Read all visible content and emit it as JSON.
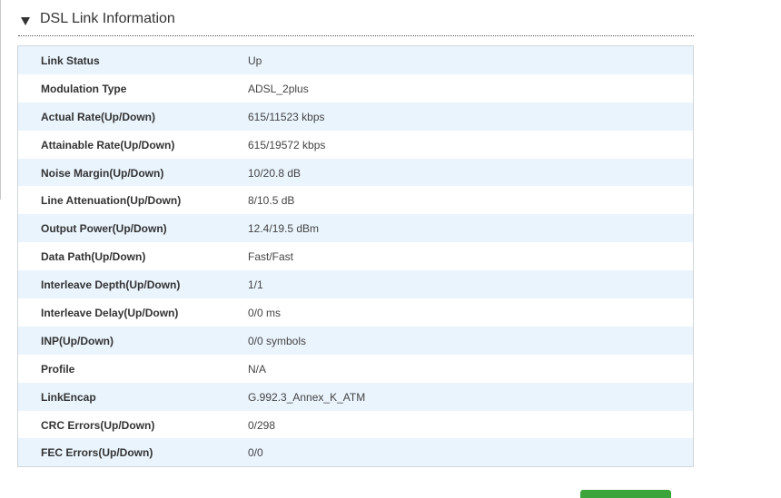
{
  "section": {
    "title": "DSL Link Information"
  },
  "rows": [
    {
      "label": "Link Status",
      "value": "Up"
    },
    {
      "label": "Modulation Type",
      "value": "ADSL_2plus"
    },
    {
      "label": "Actual Rate(Up/Down)",
      "value": "615/11523 kbps"
    },
    {
      "label": "Attainable Rate(Up/Down)",
      "value": "615/19572 kbps"
    },
    {
      "label": "Noise Margin(Up/Down)",
      "value": "10/20.8 dB"
    },
    {
      "label": "Line Attenuation(Up/Down)",
      "value": "8/10.5 dB"
    },
    {
      "label": "Output Power(Up/Down)",
      "value": "12.4/19.5 dBm"
    },
    {
      "label": "Data Path(Up/Down)",
      "value": "Fast/Fast"
    },
    {
      "label": "Interleave Depth(Up/Down)",
      "value": "1/1"
    },
    {
      "label": "Interleave Delay(Up/Down)",
      "value": "0/0 ms"
    },
    {
      "label": "INP(Up/Down)",
      "value": "0/0 symbols"
    },
    {
      "label": "Profile",
      "value": "N/A"
    },
    {
      "label": "LinkEncap",
      "value": "G.992.3_Annex_K_ATM"
    },
    {
      "label": "CRC Errors(Up/Down)",
      "value": "0/298"
    },
    {
      "label": "FEC Errors(Up/Down)",
      "value": "0/0"
    }
  ],
  "colors": {
    "row_alt": "#eaf4fd",
    "button_green": "#3ba53b"
  }
}
